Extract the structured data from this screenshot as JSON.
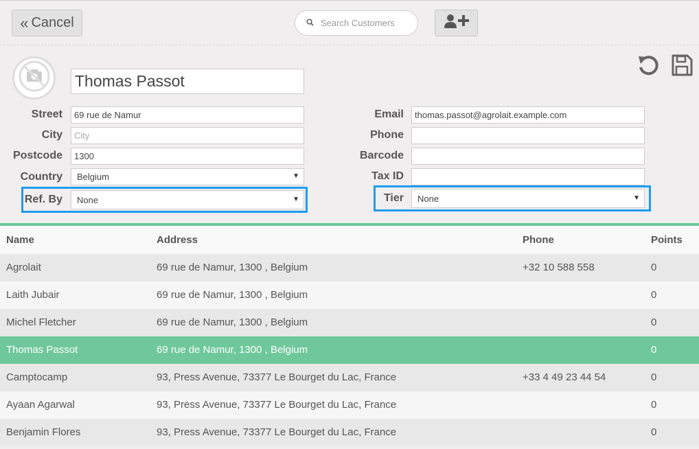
{
  "toolbar": {
    "cancel_label": "Cancel",
    "search_placeholder": "Search Customers"
  },
  "customer": {
    "name": "Thomas Passot",
    "street_label": "Street",
    "street": "69 rue de Namur",
    "city_label": "City",
    "city": "",
    "city_placeholder": "City",
    "postcode_label": "Postcode",
    "postcode": "1300",
    "country_label": "Country",
    "country": "Belgium",
    "refby_label": "Ref. By",
    "refby": "None",
    "email_label": "Email",
    "email": "thomas.passot@agrolait.example.com",
    "phone_label": "Phone",
    "phone": "",
    "barcode_label": "Barcode",
    "barcode": "",
    "taxid_label": "Tax ID",
    "taxid": "",
    "tier_label": "Tier",
    "tier": "None"
  },
  "list": {
    "headers": {
      "name": "Name",
      "address": "Address",
      "phone": "Phone",
      "points": "Points"
    },
    "rows": [
      {
        "name": "Agrolait",
        "address": "69 rue de Namur, 1300 , Belgium",
        "phone": "+32 10 588 558",
        "points": "0"
      },
      {
        "name": "Laith Jubair",
        "address": "69 rue de Namur, 1300 , Belgium",
        "phone": "",
        "points": "0"
      },
      {
        "name": "Michel Fletcher",
        "address": "69 rue de Namur, 1300 , Belgium",
        "phone": "",
        "points": "0"
      },
      {
        "name": "Thomas Passot",
        "address": "69 rue de Namur, 1300 , Belgium",
        "phone": "",
        "points": "0"
      },
      {
        "name": "Camptocamp",
        "address": "93, Press Avenue, 73377 Le Bourget du Lac, France",
        "phone": "+33 4 49 23 44 54",
        "points": "0"
      },
      {
        "name": "Ayaan Agarwal",
        "address": "93, Press Avenue, 73377 Le Bourget du Lac, France",
        "phone": "",
        "points": "0"
      },
      {
        "name": "Benjamin Flores",
        "address": "93, Press Avenue, 73377 Le Bourget du Lac, France",
        "phone": "",
        "points": "0"
      }
    ]
  },
  "colors": {
    "accent_green": "#6ec89b",
    "highlight_blue": "#1e9cf0"
  }
}
